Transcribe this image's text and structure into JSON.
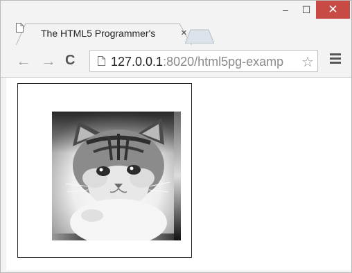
{
  "window": {
    "minimize_symbol": "–",
    "maximize_symbol": "☐",
    "close_symbol": "✕",
    "close_color": "#c84a45"
  },
  "tab": {
    "title": "The HTML5 Programmer's",
    "close_symbol": "×"
  },
  "toolbar": {
    "back_symbol": "←",
    "forward_symbol": "→",
    "reload_symbol": "C",
    "url_host": "127.0.0.1",
    "url_path": ":8020/html5pg-examp",
    "star_symbol": "☆"
  },
  "page": {
    "image_alt": "kitten photo with grayscale filter",
    "image_icon": "kitten-photo"
  }
}
